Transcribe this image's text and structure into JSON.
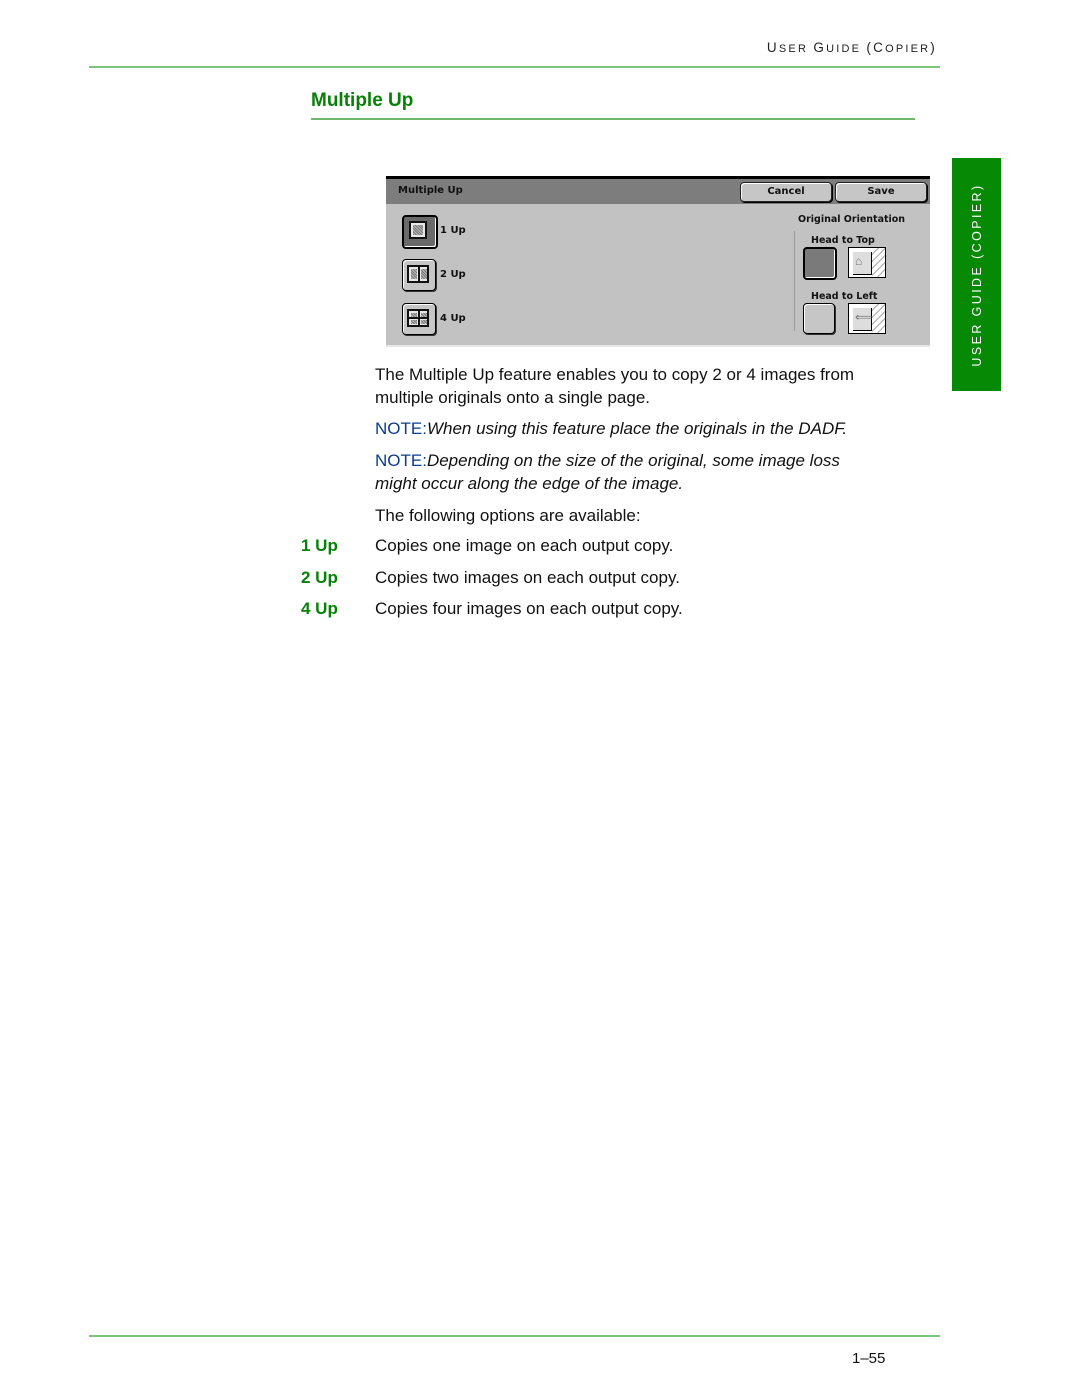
{
  "header": {
    "running_title_parts": [
      {
        "text": "U",
        "big": true
      },
      {
        "text": "SER ",
        "big": false
      },
      {
        "text": "G",
        "big": true
      },
      {
        "text": "UIDE ",
        "big": false
      },
      {
        "text": "(C",
        "big": true
      },
      {
        "text": "OPIER",
        "big": false
      },
      {
        "text": ")",
        "big": true
      }
    ]
  },
  "side_tab": {
    "label": "USER GUIDE (COPIER)"
  },
  "section": {
    "title": "Multiple Up"
  },
  "screen": {
    "title": "Multiple Up",
    "cancel_label": "Cancel",
    "save_label": "Save",
    "options": [
      {
        "label": "1 Up",
        "selected": true,
        "icon": "one-up-icon"
      },
      {
        "label": "2 Up",
        "selected": false,
        "icon": "two-up-icon"
      },
      {
        "label": "4 Up",
        "selected": false,
        "icon": "four-up-icon"
      }
    ],
    "orientation": {
      "heading": "Original Orientation",
      "head_to_top": {
        "label": "Head to Top",
        "selected": true,
        "icon": "portrait-page-icon"
      },
      "head_to_left": {
        "label": "Head to Left",
        "selected": false,
        "icon": "landscape-page-icon"
      }
    }
  },
  "body": {
    "intro_line1": "The Multiple Up feature enables you to copy 2 or 4 images from",
    "intro_line2": "multiple originals onto a single page.",
    "note1": {
      "label": "NOTE:",
      "text": "When using this feature place the originals in the DADF."
    },
    "note2": {
      "label": "NOTE:",
      "text_line1": "Depending on the size of the original, some image loss",
      "text_line2": "might occur along the edge of the image."
    },
    "options_intro": "The following options are available:",
    "definitions": [
      {
        "term": "1 Up",
        "desc": "Copies one image on each output copy."
      },
      {
        "term": "2 Up",
        "desc": "Copies two images on each output copy."
      },
      {
        "term": "4 Up",
        "desc": "Copies four images on each output copy."
      }
    ]
  },
  "footer": {
    "page_number": "1–55"
  },
  "colors": {
    "accent_green": "#078107",
    "note_blue": "#0a3d8c",
    "rule_green": "#7dc27d"
  }
}
